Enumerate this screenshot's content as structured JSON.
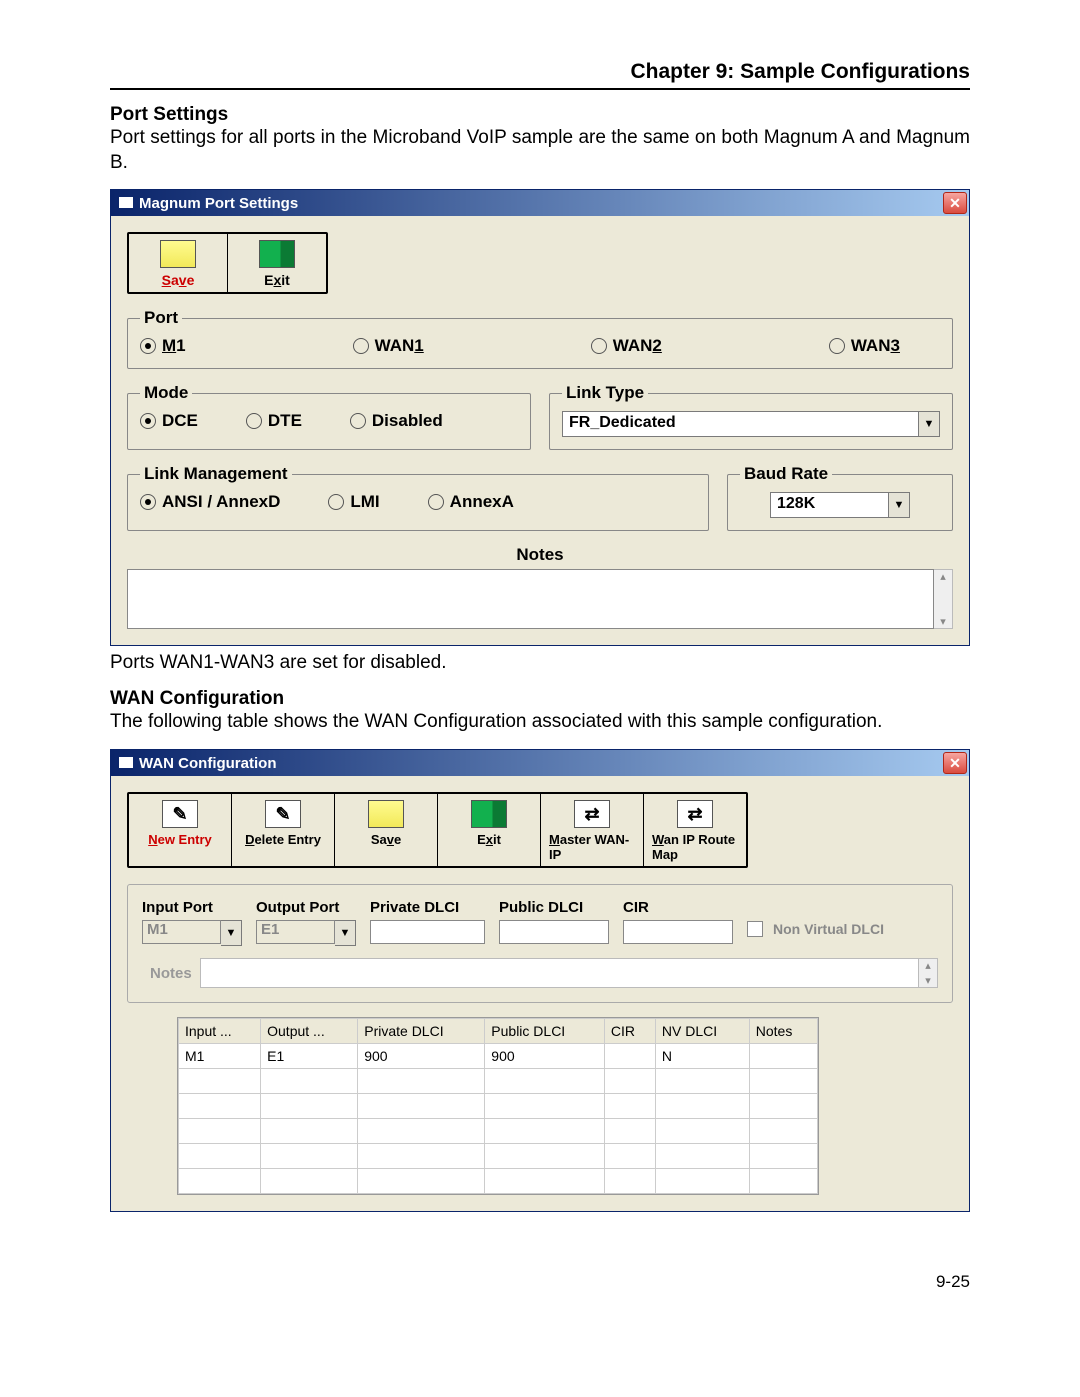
{
  "chapter_title": "Chapter 9: Sample Configurations",
  "section_port_settings": {
    "heading": "Port Settings",
    "text": "Port settings for all ports in the Microband VoIP sample are the same on both Magnum A and Magnum B."
  },
  "port_dlg": {
    "title": "Magnum Port Settings",
    "save": "Save",
    "save_hot": "v",
    "exit": "Exit",
    "exit_hot": "x",
    "port_legend": "Port",
    "radios": [
      {
        "label": "M1",
        "hot": "M",
        "sel": true
      },
      {
        "label": "WAN1",
        "hot": "1",
        "sel": false
      },
      {
        "label": "WAN2",
        "hot": "2",
        "sel": false
      },
      {
        "label": "WAN3",
        "hot": "3",
        "sel": false
      }
    ],
    "mode_legend": "Mode",
    "mode": [
      {
        "label": "DCE",
        "sel": true
      },
      {
        "label": "DTE",
        "sel": false
      },
      {
        "label": "Disabled",
        "sel": false
      }
    ],
    "linktype_legend": "Link Type",
    "linktype_value": "FR_Dedicated",
    "linkmgmt_legend": "Link Management",
    "linkmgmt": [
      {
        "label": "ANSI / AnnexD",
        "sel": true
      },
      {
        "label": "LMI",
        "sel": false
      },
      {
        "label": "AnnexA",
        "sel": false
      }
    ],
    "baud_legend": "Baud Rate",
    "baud_value": "128K",
    "notes_label": "Notes"
  },
  "port_caption": "Ports WAN1-WAN3 are set for disabled.",
  "section_wan": {
    "heading": "WAN Configuration",
    "text": "The following table shows the WAN Configuration associated with this sample configuration."
  },
  "wan_dlg": {
    "title": "WAN Configuration",
    "tools": [
      {
        "label": "New Entry",
        "hot": "N",
        "red": true
      },
      {
        "label": "Delete Entry",
        "hot": "D"
      },
      {
        "label": "Save",
        "hot": "v"
      },
      {
        "label": "Exit",
        "hot": "x"
      },
      {
        "label": "Master WAN-IP",
        "hot": "M"
      },
      {
        "label": "Wan IP Route Map",
        "hot": "W"
      }
    ],
    "fields": {
      "input_port": {
        "label": "Input Port",
        "value": "M1"
      },
      "output_port": {
        "label": "Output Port",
        "value": "E1"
      },
      "private_dlci": {
        "label": "Private DLCI",
        "value": ""
      },
      "public_dlci": {
        "label": "Public DLCI",
        "value": ""
      },
      "cir": {
        "label": "CIR",
        "value": ""
      },
      "nonvirtual": "Non Virtual DLCI",
      "notes": "Notes"
    },
    "table": {
      "headers": [
        "Input ...",
        "Output ...",
        "Private DLCI",
        "Public DLCI",
        "CIR",
        "NV DLCI",
        "Notes"
      ],
      "rows": [
        [
          "M1",
          "E1",
          "900",
          "900",
          "",
          "N",
          ""
        ]
      ]
    }
  },
  "page_number": "9-25"
}
